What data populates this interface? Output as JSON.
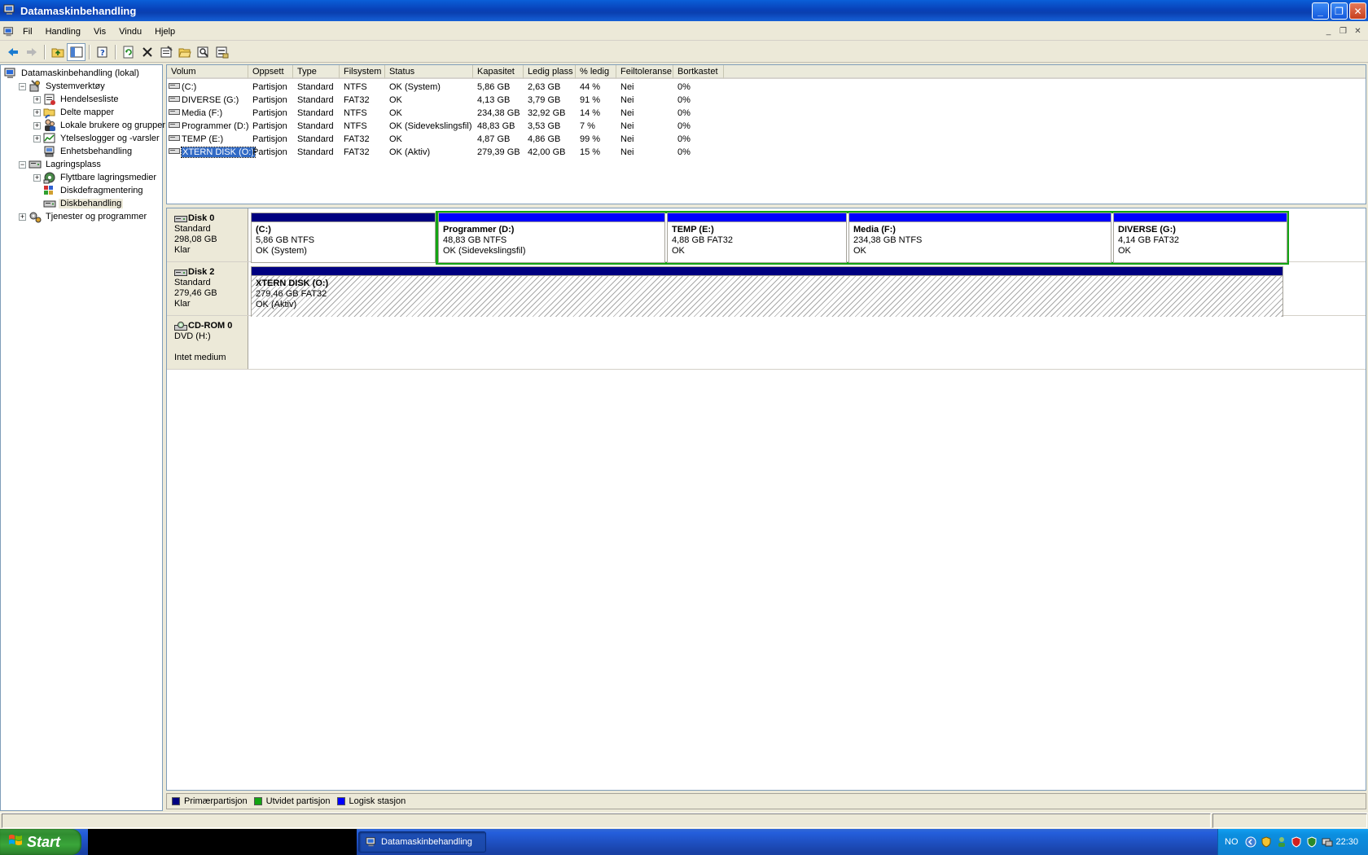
{
  "window": {
    "title": "Datamaskinbehandling"
  },
  "menu": [
    "Fil",
    "Handling",
    "Vis",
    "Vindu",
    "Hjelp"
  ],
  "toolbar_icons": [
    "back-arrow-icon",
    "forward-arrow-icon",
    "up-folder-icon",
    "show-hide-tree-icon",
    "help-icon",
    "refresh-icon",
    "delete-icon",
    "properties-icon",
    "open-folder-icon",
    "search-icon",
    "settings-icon"
  ],
  "tree": [
    {
      "label": "Datamaskinbehandling (lokal)",
      "level": 0,
      "expander": "none",
      "icon": "computer-icon"
    },
    {
      "label": "Systemverktøy",
      "level": 1,
      "expander": "-",
      "icon": "tools-icon"
    },
    {
      "label": "Hendelsesliste",
      "level": 2,
      "expander": "+",
      "icon": "event-log-icon"
    },
    {
      "label": "Delte mapper",
      "level": 2,
      "expander": "+",
      "icon": "shared-folder-icon"
    },
    {
      "label": "Lokale brukere og grupper",
      "level": 2,
      "expander": "+",
      "icon": "users-icon"
    },
    {
      "label": "Ytelseslogger og -varsler",
      "level": 2,
      "expander": "+",
      "icon": "performance-icon"
    },
    {
      "label": "Enhetsbehandling",
      "level": 2,
      "expander": "none",
      "icon": "device-manager-icon"
    },
    {
      "label": "Lagringsplass",
      "level": 1,
      "expander": "-",
      "icon": "storage-icon"
    },
    {
      "label": "Flyttbare lagringsmedier",
      "level": 2,
      "expander": "+",
      "icon": "removable-storage-icon"
    },
    {
      "label": "Diskdefragmentering",
      "level": 2,
      "expander": "none",
      "icon": "defrag-icon"
    },
    {
      "label": "Diskbehandling",
      "level": 2,
      "expander": "none",
      "icon": "disk-management-icon",
      "selected": true
    },
    {
      "label": "Tjenester og programmer",
      "level": 1,
      "expander": "+",
      "icon": "services-icon"
    }
  ],
  "list": {
    "columns": [
      "Volum",
      "Oppsett",
      "Type",
      "Filsystem",
      "Status",
      "Kapasitet",
      "Ledig plass",
      "% ledig",
      "Feiltoleranse",
      "Bortkastet"
    ],
    "rows": [
      [
        "(C:)",
        "Partisjon",
        "Standard",
        "NTFS",
        "OK (System)",
        "5,86 GB",
        "2,63 GB",
        "44 %",
        "Nei",
        "0%"
      ],
      [
        "DIVERSE (G:)",
        "Partisjon",
        "Standard",
        "FAT32",
        "OK",
        "4,13 GB",
        "3,79 GB",
        "91 %",
        "Nei",
        "0%"
      ],
      [
        "Media (F:)",
        "Partisjon",
        "Standard",
        "NTFS",
        "OK",
        "234,38 GB",
        "32,92 GB",
        "14 %",
        "Nei",
        "0%"
      ],
      [
        "Programmer (D:)",
        "Partisjon",
        "Standard",
        "NTFS",
        "OK (Sidevekslingsfil)",
        "48,83 GB",
        "3,53 GB",
        "7 %",
        "Nei",
        "0%"
      ],
      [
        "TEMP (E:)",
        "Partisjon",
        "Standard",
        "FAT32",
        "OK",
        "4,87 GB",
        "4,86 GB",
        "99 %",
        "Nei",
        "0%"
      ],
      [
        "XTERN DISK (O:)",
        "Partisjon",
        "Standard",
        "FAT32",
        "OK (Aktiv)",
        "279,39 GB",
        "42,00 GB",
        "15 %",
        "Nei",
        "0%"
      ]
    ],
    "selected_row": 5
  },
  "disks": [
    {
      "name": "Disk 0",
      "type": "Standard",
      "size": "298,08 GB",
      "state": "Klar",
      "partitions": [
        {
          "name": " (C:)",
          "detail": "5,86 GB NTFS",
          "status": "OK (System)",
          "kind": "primary"
        },
        {
          "name": "Programmer  (D:)",
          "detail": "48,83 GB NTFS",
          "status": "OK (Sidevekslingsfil)",
          "kind": "logical"
        },
        {
          "name": "TEMP  (E:)",
          "detail": "4,88 GB FAT32",
          "status": "OK",
          "kind": "logical"
        },
        {
          "name": "Media  (F:)",
          "detail": "234,38 GB NTFS",
          "status": "OK",
          "kind": "logical"
        },
        {
          "name": "DIVERSE  (G:)",
          "detail": "4,14 GB FAT32",
          "status": "OK",
          "kind": "logical"
        }
      ]
    },
    {
      "name": "Disk 2",
      "type": "Standard",
      "size": "279,46 GB",
      "state": "Klar",
      "partitions": [
        {
          "name": "XTERN DISK  (O:)",
          "detail": "279,46 GB FAT32",
          "status": "OK (Aktiv)",
          "kind": "primary",
          "selected": true
        }
      ]
    },
    {
      "name": "CD-ROM 0",
      "type": "DVD (H:)",
      "size": "",
      "state": "Intet medium"
    }
  ],
  "legend": [
    {
      "label": "Primærpartisjon",
      "color": "#000080"
    },
    {
      "label": "Utvidet partisjon",
      "color": "#13a413"
    },
    {
      "label": "Logisk stasjon",
      "color": "#0000ff"
    }
  ],
  "taskbar": {
    "start": "Start",
    "task": "Datamaskinbehandling",
    "lang": "NO",
    "clock": "22:30"
  },
  "colors": {
    "primary": "#000080",
    "extended": "#13a413",
    "logical": "#0000ff",
    "selection": "#316ac5"
  }
}
